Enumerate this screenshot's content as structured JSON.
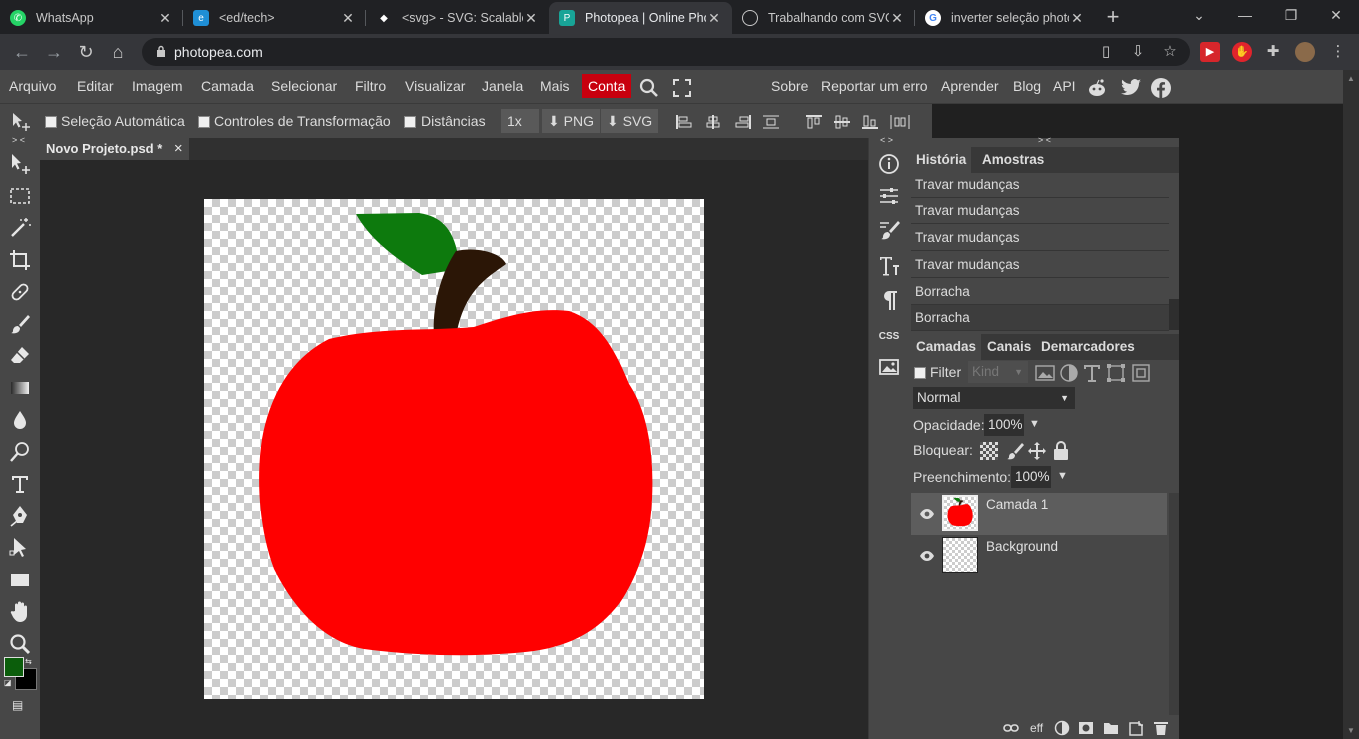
{
  "browser": {
    "tabs": [
      {
        "title": "WhatsApp",
        "icon": "whatsapp-icon",
        "color": "#25d366",
        "active": false
      },
      {
        "title": "<ed/tech>",
        "icon": "edtech-icon",
        "color": "#1f8fd6",
        "active": false
      },
      {
        "title": "<svg> - SVG: Scalable",
        "icon": "mdn-icon",
        "color": "#ffffff",
        "active": false
      },
      {
        "title": "Photopea | Online Pho",
        "icon": "photopea-icon",
        "color": "#18a497",
        "active": true
      },
      {
        "title": "Trabalhando com SVG",
        "icon": "globe-icon",
        "color": "#c8c8c8",
        "active": false
      },
      {
        "title": "inverter seleção photo",
        "icon": "google-icon",
        "color": "#4285f4",
        "active": false
      }
    ],
    "url": "photopea.com"
  },
  "menubar": {
    "items": [
      "Arquivo",
      "Editar",
      "Imagem",
      "Camada",
      "Selecionar",
      "Filtro",
      "Visualizar",
      "Janela",
      "Mais"
    ],
    "account": "Conta",
    "right": [
      "Sobre",
      "Reportar um erro",
      "Aprender",
      "Blog",
      "API"
    ]
  },
  "options": {
    "auto_select": "Seleção Automática",
    "transform_controls": "Controles de Transformação",
    "distances": "Distâncias",
    "scale": "1x",
    "png": "PNG",
    "svg": "SVG"
  },
  "document": {
    "tab_title": "Novo Projeto.psd *",
    "close": "×"
  },
  "colors": {
    "foreground": "#0b5d0b",
    "background": "#000000",
    "apple_red": "#ff0000",
    "leaf_green": "#0d7a0d",
    "stem_brown": "#2b1606",
    "accent": "#c8000e"
  },
  "panels": {
    "top_tabs": [
      "História",
      "Amostras"
    ],
    "history": [
      "Travar mudanças",
      "Travar mudanças",
      "Travar mudanças",
      "Travar mudanças",
      "Borracha",
      "Borracha"
    ],
    "layer_tabs": [
      "Camadas",
      "Canais",
      "Demarcadores"
    ],
    "filter_label": "Filter",
    "kind_placeholder": "Kind",
    "blend_mode": "Normal",
    "opacity_label": "Opacidade:",
    "opacity_value": "100%",
    "lock_label": "Bloquear:",
    "fill_label": "Preenchimento:",
    "fill_value": "100%",
    "layers": [
      {
        "name": "Camada 1",
        "selected": true
      },
      {
        "name": "Background",
        "selected": false
      }
    ],
    "footer_eff": "eff"
  },
  "collapse_toggles": {
    "left": "> <",
    "right_col": "< >",
    "panels": "> <"
  }
}
